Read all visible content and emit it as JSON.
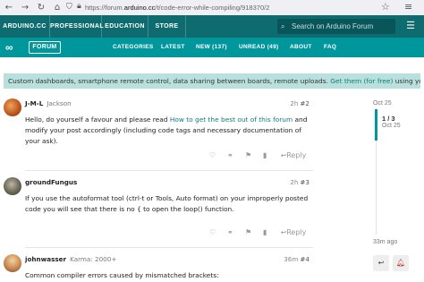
{
  "browser": {
    "back_icon": "arrow-left-icon",
    "forward_icon": "arrow-right-icon",
    "reload_icon": "reload-icon",
    "home_icon": "home-icon",
    "url_prefix": "https://forum.",
    "url_domain": "arduino.cc",
    "url_path": "/t/code-error-while-compiling/918370/2"
  },
  "topbar": {
    "tabs": [
      "ARDUINO.CC",
      "PROFESSIONAL",
      "EDUCATION",
      "STORE"
    ],
    "search_placeholder": "Search on Arduino Forum"
  },
  "mainnav": {
    "logo_text": "FORUM",
    "items": [
      "CATEGORIES",
      "LATEST",
      "NEW (137)",
      "UNREAD (49)",
      "ABOUT",
      "FAQ"
    ]
  },
  "banner": {
    "text_before": "Custom dashboards, smartphone remote control, data sharing between boards, remote uploads. ",
    "link": "Get them (for free)",
    "text_after": " using your forum account!"
  },
  "posts": [
    {
      "username": "J-M-L",
      "subtitle": "Jackson",
      "time": "2h",
      "number": "#2",
      "avatar_color": "#c9651f",
      "body_before": "Hello, do yourself a favour and please read ",
      "body_link": "How to get the best out of this forum",
      "body_after": " and modify your post accordingly (including code tags and necessary documentation of your ask).",
      "reply_label": "Reply"
    },
    {
      "username": "groundFungus",
      "subtitle": "",
      "time": "2h",
      "number": "#3",
      "avatar_color": "#5a5a4c",
      "body_before": "If you use the autoformat tool (ctrl-t or Tools, Auto format) on your improperly posted code you will see that there is no { to open the loop() function.",
      "body_link": "",
      "body_after": "",
      "reply_label": "Reply"
    },
    {
      "username": "johnwasser",
      "subtitle": "Karma: 2000+",
      "time": "36m",
      "number": "#4",
      "avatar_color": "#d9a86b",
      "body_before": "Common compiler errors caused by mismatched brackets:",
      "body_link": "",
      "body_after": "",
      "reply_label": ""
    }
  ],
  "timeline": {
    "top_date": "Oct 25",
    "counter": "1 / 3",
    "counter_date": "Oct 25",
    "bottom_label": "33m ago",
    "accent": "#00979c"
  }
}
